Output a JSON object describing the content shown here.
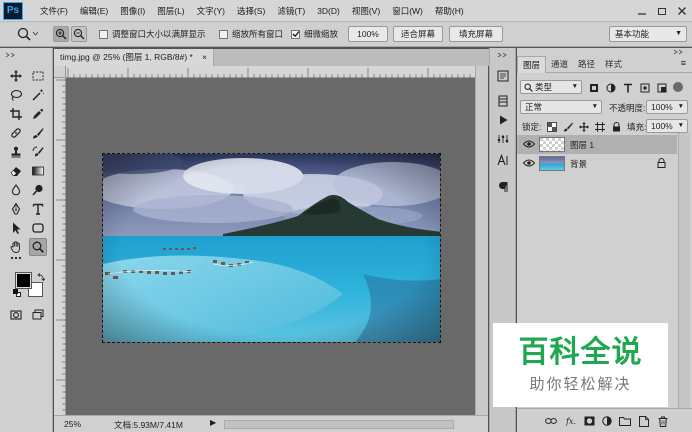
{
  "app": {
    "logo": "Ps",
    "accent": "#31a8ff"
  },
  "menu": [
    "文件(F)",
    "编辑(E)",
    "图像(I)",
    "图层(L)",
    "文字(Y)",
    "选择(S)",
    "滤镜(T)",
    "3D(D)",
    "视图(V)",
    "窗口(W)",
    "帮助(H)"
  ],
  "options_bar": {
    "tool_icon": "zoom-icon",
    "checkbox_resize": {
      "label": "调整窗口大小以满屏显示",
      "checked": false
    },
    "checkbox_all": {
      "label": "缩放所有窗口",
      "checked": false
    },
    "checkbox_scrubby": {
      "label": "细微缩放",
      "checked": true
    },
    "zoom_value": "100%",
    "fit_screen": "适合屏幕",
    "fill_screen": "填充屏幕",
    "workspace": "基本功能"
  },
  "document": {
    "tab_title": "timg.jpg @ 25% (图层 1, RGB/8#) *",
    "tab_close": "×",
    "status_zoom": "25%",
    "status_doc": "文档:5.93M/7.41M",
    "image_content": [
      "cloudy-sky",
      "mountain-island",
      "turquoise-lagoon",
      "overwater-bungalows"
    ]
  },
  "layers_panel": {
    "tabs": [
      "图层",
      "通道",
      "路径",
      "样式"
    ],
    "active_tab": 0,
    "filter_kind": "类型",
    "blend_mode": "正常",
    "opacity_label": "不透明度:",
    "opacity_value": "100%",
    "lock_label": "锁定:",
    "fill_label": "填充:",
    "fill_value": "100%",
    "layers": [
      {
        "name": "图层 1",
        "selected": true,
        "visible": true,
        "locked": false
      },
      {
        "name": "背景",
        "selected": false,
        "visible": true,
        "locked": true
      }
    ]
  },
  "watermark": {
    "title": "百科全说",
    "subtitle": "助你轻松解决",
    "color": "#21a750"
  }
}
